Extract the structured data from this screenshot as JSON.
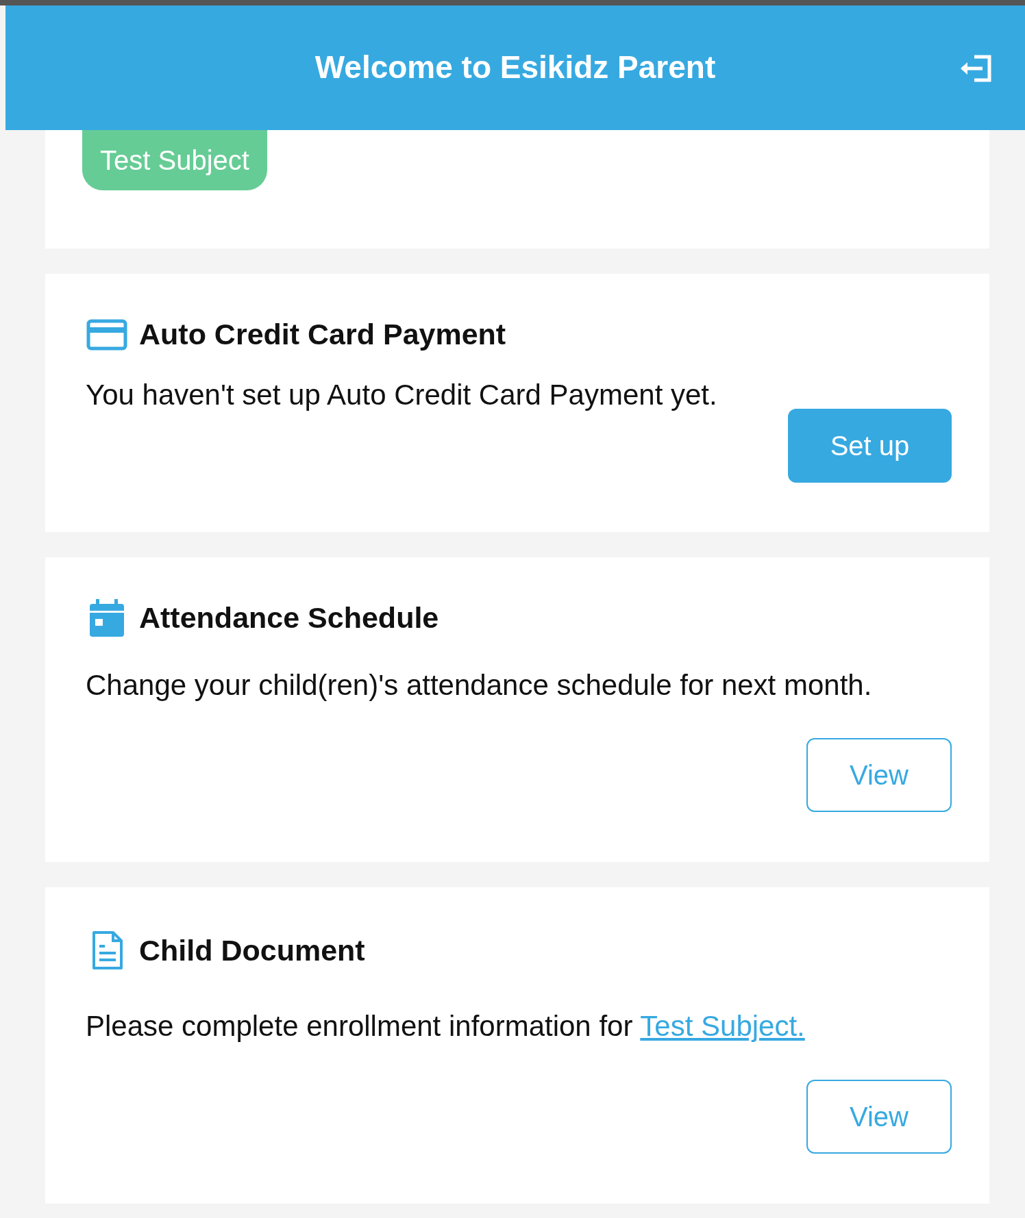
{
  "header": {
    "title": "Welcome to Esikidz Parent"
  },
  "child_badge": {
    "label": "Test Subject"
  },
  "cards": [
    {
      "kind": "payment",
      "title": "Auto Credit Card Payment",
      "description": "You haven't set up Auto Credit Card Payment yet.",
      "button": {
        "label": "Set up"
      }
    },
    {
      "kind": "schedule",
      "title": "Attendance Schedule",
      "description": "Change your child(ren)'s attendance schedule for next month.",
      "button": {
        "label": "View"
      }
    },
    {
      "kind": "document",
      "title": "Child Document",
      "description": "Please complete enrollment information for",
      "link": "Test Subject.",
      "button": {
        "label": "View"
      }
    }
  ]
}
